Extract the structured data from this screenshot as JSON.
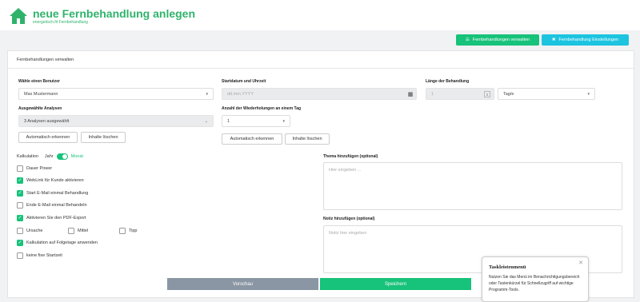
{
  "header": {
    "title": "neue Fernbehandlung anlegen",
    "subtitle": "energetisch.fit Fernbehandlung"
  },
  "top_buttons": {
    "manage": "Fernbehandlungen verwalten",
    "settings": "Fernbehandlung Einstellungen"
  },
  "card": {
    "title": "Fernbehandlungen verwalten"
  },
  "user": {
    "label": "Wähle einen Benutzer",
    "value": "Max Mustermann"
  },
  "start": {
    "label": "Startdatum und Uhrzeit",
    "placeholder": "dd.mm.YYYY"
  },
  "length": {
    "label": "Länge der Behandlung",
    "value": "1",
    "unit": "Tag/e"
  },
  "analyses": {
    "label": "Ausgewählte Analysen",
    "value": "3 Analysen ausgewählt",
    "btn_auto": "Automatisch erkennen",
    "btn_clear": "Inhalte löschen"
  },
  "repeat": {
    "label": "Anzahl der Wiederholungen an einem Tag",
    "value": "1",
    "btn_auto": "Automatisch erkennen",
    "btn_clear": "Inhalte löschen"
  },
  "calc": {
    "label": "Kalkulation",
    "left": "Jahr",
    "right": "Monat"
  },
  "checks": {
    "dauer": "Dauer Power",
    "weblink": "WebLink für Kunde aktivieren",
    "start_mail": "Start E-Mail einmal Behandlung",
    "end_mail": "Ende E-Mail einmal Behandeln",
    "pdf": "Aktivieren Sie den PDF-Export",
    "ursache": "Ursache",
    "mittel": "Mittel",
    "tipp": "Tipp",
    "folgetage": "Kalkulation auf Folgetage anwenden",
    "startzeit": "keine fixe Startzeit"
  },
  "thema": {
    "label": "Thema hinzufügen (optional)",
    "placeholder": "Hier eingeben ..."
  },
  "notiz": {
    "label": "Notiz hinzufügen (optional)",
    "placeholder": "Notiz hier eingeben"
  },
  "actions": {
    "preview": "Vorschau",
    "save": "Speichern"
  },
  "popup": {
    "title": "Taskleistenmenü",
    "text": "Nutzen Sie das Menü im Benachrichtigungsbereich oder Tastenkürzel für Schnellzugriff auf wichtige Programm-Tools."
  },
  "colors": {
    "accent": "#17c27a",
    "cyan": "#1cc4e0",
    "grey_btn": "#8a96a3"
  }
}
